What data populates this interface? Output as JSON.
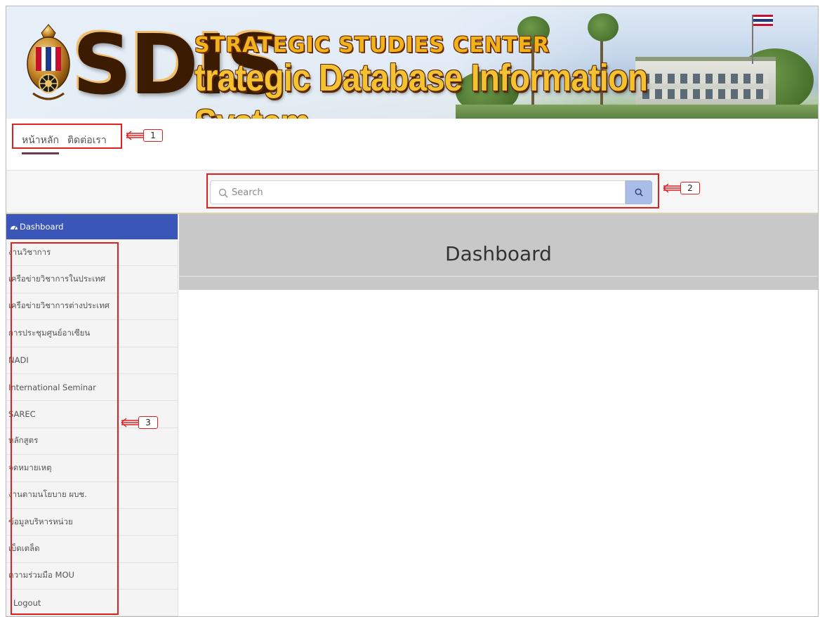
{
  "banner": {
    "logo_mark": "SDIS",
    "tagline_top": "STRATEGIC STUDIES CENTER",
    "tagline_bottom": "trategic Database Information System"
  },
  "topnav": {
    "links": [
      {
        "label": "หน้าหลัก",
        "active": true
      },
      {
        "label": "ติดต่อเรา",
        "active": false
      }
    ]
  },
  "search": {
    "placeholder": "Search",
    "value": "",
    "icon": "search-icon",
    "button_icon": "search-icon"
  },
  "sidebar": {
    "header": {
      "icon": "dashboard-icon",
      "label": "Dashboard"
    },
    "items": [
      {
        "label": "งานวิชาการ"
      },
      {
        "label": "เครือข่ายวิชาการในประเทศ"
      },
      {
        "label": "เครือข่ายวิชาการต่างประเทศ"
      },
      {
        "label": "การประชุมศูนย์อาเซียน"
      },
      {
        "label": "NADI"
      },
      {
        "label": "International Seminar"
      },
      {
        "label": "SAREC"
      },
      {
        "label": "หลักสูตร"
      },
      {
        "label": "จดหมายเหตุ"
      },
      {
        "label": "งานตามนโยบาย ผบช."
      },
      {
        "label": "ข้อมูลบริหารหน่วย"
      },
      {
        "label": "เบ็ดเตล็ด"
      },
      {
        "label": "ความร่วมมือ MOU"
      },
      {
        "label": "Logout"
      }
    ]
  },
  "main": {
    "title": "Dashboard"
  },
  "annotations": [
    {
      "number": "1"
    },
    {
      "number": "2"
    },
    {
      "number": "3"
    }
  ],
  "colors": {
    "sidebar_header": "#3a56b8",
    "annotation": "#e02020",
    "search_button": "#a9bde9",
    "content_header": "#c8c8c8",
    "active_underline": "#6d3a55"
  }
}
